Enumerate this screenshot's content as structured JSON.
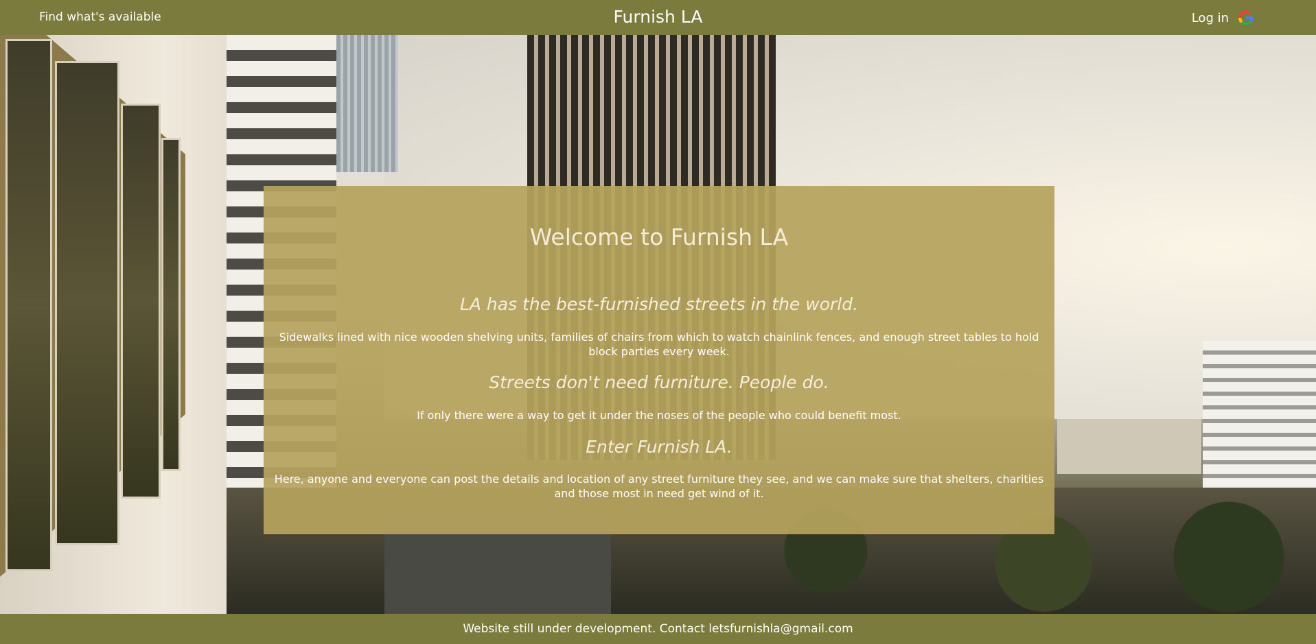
{
  "navbar": {
    "left_link": "Find what's available",
    "title": "Furnish LA",
    "login_label": "Log in",
    "login_icon": "google-icon"
  },
  "main": {
    "welcome": "Welcome to Furnish LA",
    "heading1": "LA has the best-furnished streets in the world.",
    "para1": "Sidewalks lined with nice wooden shelving units, families of chairs from which to watch chainlink fences, and enough street tables to hold block parties every week.",
    "heading2": "Streets don't need furniture. People do.",
    "para2": "If only there were a way to get it under the noses of the people who could benefit most.",
    "heading3": "Enter Furnish LA.",
    "para3": "Here, anyone and everyone can post the details and location of any street furniture they see, and we can make sure that shelters, charities and those most in need get wind of it."
  },
  "footer": {
    "text": "Website still under development. Contact letsfurnishla@gmail.com"
  },
  "colors": {
    "navbar_bg": "#7a7b3d",
    "overlay_bg": "#b5a25d",
    "text": "#ffffff"
  }
}
